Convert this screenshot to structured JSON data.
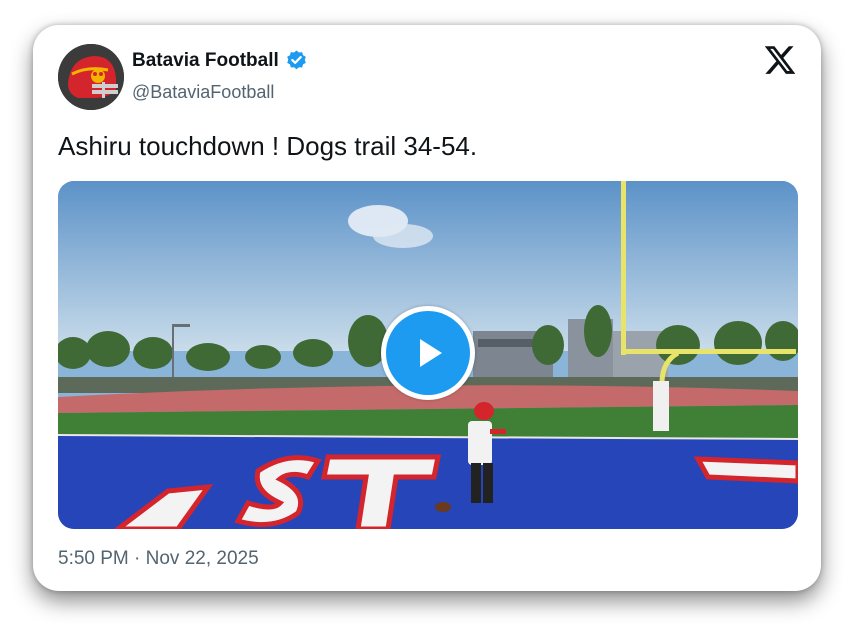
{
  "tweet": {
    "display_name": "Batavia Football",
    "verified": true,
    "handle": "@BataviaFootball",
    "text": "Ashiru touchdown ! Dogs trail 34-54.",
    "timestamp": "5:50 PM · Nov 22, 2025"
  },
  "media": {
    "type": "video",
    "play_icon": "play-icon",
    "endzone_text": "ST"
  },
  "icons": {
    "platform": "x-logo-icon",
    "verified": "verified-badge-icon"
  },
  "colors": {
    "accent": "#1d9bf0",
    "text_primary": "#0f1419",
    "text_secondary": "#536471"
  }
}
